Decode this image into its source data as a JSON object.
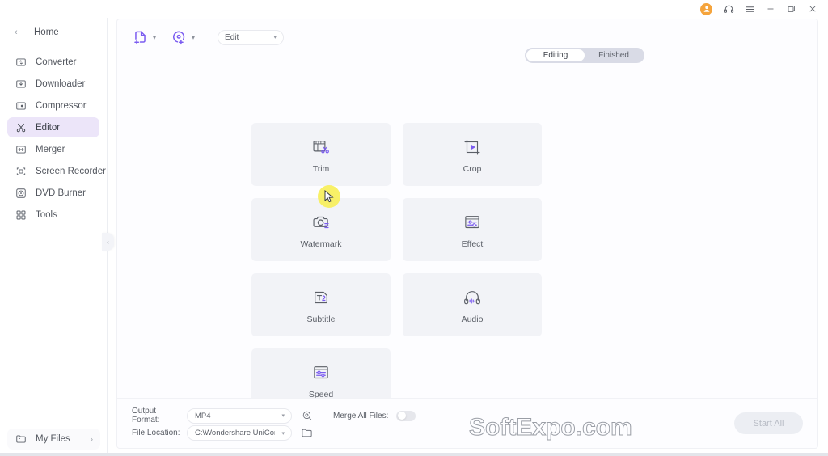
{
  "titlebar": {
    "avatar_icon": "user-avatar-icon",
    "support_icon": "headset-icon",
    "menu_icon": "hamburger-menu-icon",
    "minimize_icon": "minimize-icon",
    "maximize_icon": "maximize-icon",
    "close_icon": "close-icon"
  },
  "sidebar": {
    "home_label": "Home",
    "back_icon": "chevron-left-icon",
    "items": [
      {
        "label": "Converter",
        "icon": "converter-icon",
        "active": false
      },
      {
        "label": "Downloader",
        "icon": "downloader-icon",
        "active": false
      },
      {
        "label": "Compressor",
        "icon": "compressor-icon",
        "active": false
      },
      {
        "label": "Editor",
        "icon": "editor-scissors-icon",
        "active": true
      },
      {
        "label": "Merger",
        "icon": "merger-icon",
        "active": false
      },
      {
        "label": "Screen Recorder",
        "icon": "screen-recorder-icon",
        "active": false
      },
      {
        "label": "DVD Burner",
        "icon": "dvd-burner-icon",
        "active": false
      },
      {
        "label": "Tools",
        "icon": "tools-grid-icon",
        "active": false
      }
    ],
    "my_files_label": "My Files",
    "my_files_icon": "folder-icon",
    "my_files_arrow": "›",
    "collapse_icon": "‹"
  },
  "toolbar": {
    "add_file_icon": "add-file-icon",
    "add_disc_icon": "add-disc-icon",
    "caret": "▾",
    "mode_select_value": "Edit"
  },
  "segment": {
    "editing_label": "Editing",
    "finished_label": "Finished",
    "active": "Editing"
  },
  "cards": [
    {
      "label": "Trim",
      "icon": "trim-film-scissors-icon"
    },
    {
      "label": "Crop",
      "icon": "crop-frame-icon"
    },
    {
      "label": "Watermark",
      "icon": "watermark-camera-icon"
    },
    {
      "label": "Effect",
      "icon": "effect-sliders-icon"
    },
    {
      "label": "Subtitle",
      "icon": "subtitle-text-icon"
    },
    {
      "label": "Audio",
      "icon": "audio-headphones-icon"
    },
    {
      "label": "Speed",
      "icon": "speed-sliders-icon"
    }
  ],
  "bottom": {
    "output_format_label": "Output Format:",
    "output_format_value": "MP4",
    "settings_icon": "format-settings-icon",
    "file_location_label": "File Location:",
    "file_location_value": "C:\\Wondershare UniConverter ·",
    "folder_icon": "open-folder-icon",
    "merge_label": "Merge All Files:",
    "merge_enabled": false,
    "start_all_label": "Start All",
    "start_all_enabled": false,
    "caret": "▾"
  },
  "watermark": {
    "text": "SoftExpo.com"
  },
  "colors": {
    "accent_purple": "#7b5cf0",
    "active_nav_bg": "#ece5f9",
    "card_bg": "#f2f3f7",
    "panel_bg": "#fdfdff",
    "avatar_orange": "#f5a43c",
    "cursor_highlight": "#f7ef5a"
  }
}
